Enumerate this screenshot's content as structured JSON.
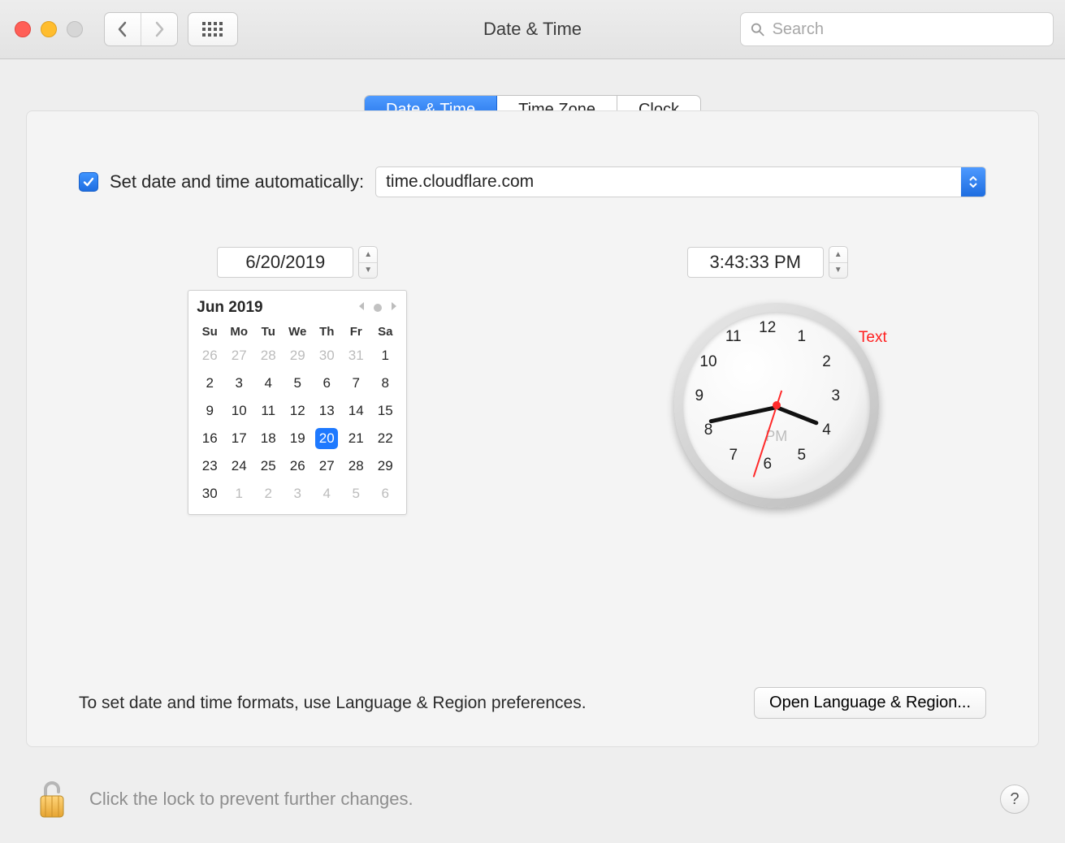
{
  "window": {
    "title": "Date & Time"
  },
  "search": {
    "placeholder": "Search",
    "value": ""
  },
  "tabs": [
    {
      "label": "Date & Time",
      "active": true
    },
    {
      "label": "Time Zone",
      "active": false
    },
    {
      "label": "Clock",
      "active": false
    }
  ],
  "auto": {
    "checked": true,
    "label": "Set date and time automatically:",
    "server": "time.cloudflare.com"
  },
  "date_field": "6/20/2019",
  "time_field": "3:43:33 PM",
  "calendar": {
    "month_label": "Jun 2019",
    "weekdays": [
      "Su",
      "Mo",
      "Tu",
      "We",
      "Th",
      "Fr",
      "Sa"
    ],
    "weeks": [
      [
        {
          "n": "26",
          "other": true
        },
        {
          "n": "27",
          "other": true
        },
        {
          "n": "28",
          "other": true
        },
        {
          "n": "29",
          "other": true
        },
        {
          "n": "30",
          "other": true
        },
        {
          "n": "31",
          "other": true
        },
        {
          "n": "1"
        }
      ],
      [
        {
          "n": "2"
        },
        {
          "n": "3"
        },
        {
          "n": "4"
        },
        {
          "n": "5"
        },
        {
          "n": "6"
        },
        {
          "n": "7"
        },
        {
          "n": "8"
        }
      ],
      [
        {
          "n": "9"
        },
        {
          "n": "10"
        },
        {
          "n": "11"
        },
        {
          "n": "12"
        },
        {
          "n": "13"
        },
        {
          "n": "14"
        },
        {
          "n": "15"
        }
      ],
      [
        {
          "n": "16"
        },
        {
          "n": "17"
        },
        {
          "n": "18"
        },
        {
          "n": "19"
        },
        {
          "n": "20",
          "selected": true
        },
        {
          "n": "21"
        },
        {
          "n": "22"
        }
      ],
      [
        {
          "n": "23"
        },
        {
          "n": "24"
        },
        {
          "n": "25"
        },
        {
          "n": "26"
        },
        {
          "n": "27"
        },
        {
          "n": "28"
        },
        {
          "n": "29"
        }
      ],
      [
        {
          "n": "30"
        },
        {
          "n": "1",
          "other": true
        },
        {
          "n": "2",
          "other": true
        },
        {
          "n": "3",
          "other": true
        },
        {
          "n": "4",
          "other": true
        },
        {
          "n": "5",
          "other": true
        },
        {
          "n": "6",
          "other": true
        }
      ]
    ]
  },
  "clock": {
    "numbers": [
      "12",
      "1",
      "2",
      "3",
      "4",
      "5",
      "6",
      "7",
      "8",
      "9",
      "10",
      "11"
    ],
    "pm_label": "PM",
    "hours": 3,
    "minutes": 43,
    "seconds": 33,
    "text_annotation": "Text"
  },
  "formats_hint": "To set date and time formats, use Language & Region preferences.",
  "open_lang_region": "Open Language & Region...",
  "lock_hint": "Click the lock to prevent further changes.",
  "help_label": "?"
}
